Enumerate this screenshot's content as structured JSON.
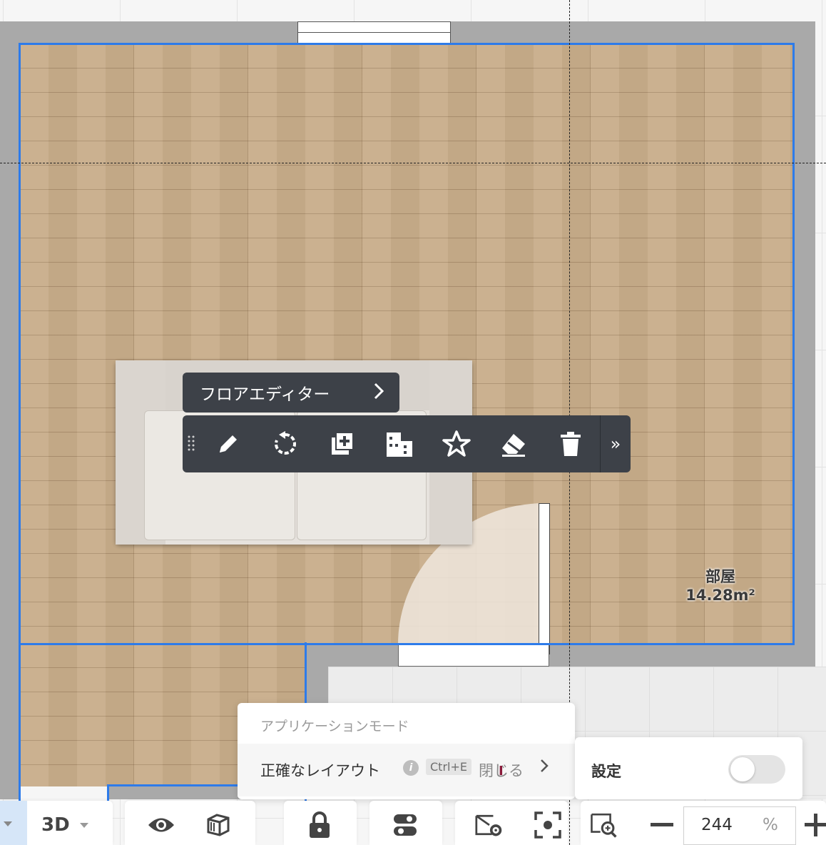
{
  "floor_editor": {
    "label": "フロアエディター",
    "chevron": "›"
  },
  "toolbar": {
    "buttons": [
      "edit-icon",
      "rotate-icon",
      "duplicate-icon",
      "material-icon",
      "favorite-icon",
      "eraser-icon",
      "trash-icon"
    ],
    "more_label": "»"
  },
  "room": {
    "name": "部屋",
    "area": "14.28m²"
  },
  "app_mode_popup": {
    "header": "アプリケーションモード",
    "mode_label": "正確なレイアウト",
    "info_glyph": "i",
    "shortcut": "Ctrl+E",
    "close_label": "閉じる",
    "chevron": "›"
  },
  "settings_panel": {
    "label": "設定",
    "toggle_on": false
  },
  "bottom_toolbar": {
    "view_mode": "3D",
    "zoom_value": "244",
    "zoom_unit": "%",
    "icons": [
      "eye-icon",
      "box-icon",
      "lock-icon",
      "toggle-icon",
      "camera-settings-icon",
      "focus-icon",
      "zoom-search-icon",
      "minus-icon",
      "plus-icon"
    ]
  },
  "colors": {
    "accent": "#2d7bea",
    "toolbar_bg": "#3d4148",
    "wall": "#a9a9a9"
  }
}
